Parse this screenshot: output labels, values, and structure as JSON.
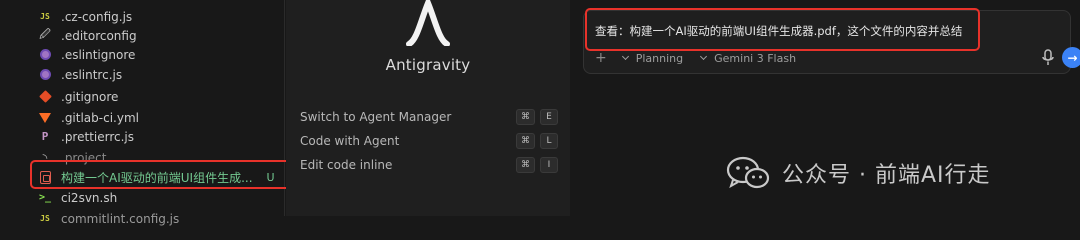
{
  "explorer": {
    "files": [
      {
        "name": ".cz-config.js",
        "icon": "javascript-file-icon"
      },
      {
        "name": ".editorconfig",
        "icon": "editorconfig-file-icon"
      },
      {
        "name": ".eslintignore",
        "icon": "eslint-file-icon"
      },
      {
        "name": ".eslintrc.js",
        "icon": "eslint-file-icon"
      },
      {
        "name": ".gitignore",
        "icon": "git-file-icon"
      },
      {
        "name": ".gitlab-ci.yml",
        "icon": "gitlab-file-icon"
      },
      {
        "name": ".prettierrc.js",
        "icon": "prettier-file-icon"
      },
      {
        "name": ".project",
        "icon": "rss-file-icon"
      },
      {
        "name": "构建一个AI驱动的前端UI组件生成...",
        "icon": "pdf-file-icon",
        "git_status": "U"
      },
      {
        "name": "ci2svn.sh",
        "icon": "shell-file-icon"
      },
      {
        "name": "commitlint.config.js",
        "icon": "javascript-file-icon"
      }
    ],
    "highlight_color": "#e8322a",
    "untracked_color": "#73c991"
  },
  "welcome": {
    "app_name": "Antigravity",
    "shortcuts": [
      {
        "label": "Switch to Agent Manager",
        "keys": [
          "⌘",
          "E"
        ]
      },
      {
        "label": "Code with Agent",
        "keys": [
          "⌘",
          "L"
        ]
      },
      {
        "label": "Edit code inline",
        "keys": [
          "⌘",
          "I"
        ]
      }
    ]
  },
  "chat": {
    "prompt": "查看：构建一个AI驱动的前端UI组件生成器.pdf，这个文件的内容并总结",
    "add_icon": "+",
    "mode": "Planning",
    "model": "Gemini 3 Flash",
    "send_icon": "→",
    "accent": "#3b82f6"
  },
  "watermark": {
    "text": "公众号 · 前端AI行走"
  }
}
